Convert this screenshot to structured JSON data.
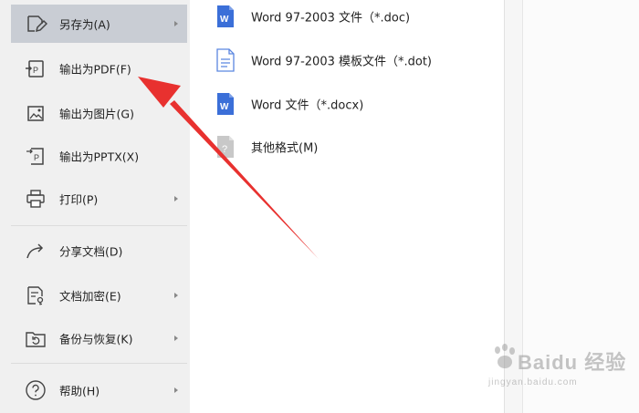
{
  "menu": {
    "items": [
      {
        "label": "另存为(A)",
        "icon": "save-as-icon",
        "has_submenu": true,
        "active": true
      },
      {
        "label": "输出为PDF(F)",
        "icon": "export-pdf-icon",
        "has_submenu": false
      },
      {
        "label": "输出为图片(G)",
        "icon": "export-image-icon",
        "has_submenu": false
      },
      {
        "label": "输出为PPTX(X)",
        "icon": "export-pptx-icon",
        "has_submenu": false
      },
      {
        "label": "打印(P)",
        "icon": "printer-icon",
        "has_submenu": true
      },
      {
        "label": "分享文档(D)",
        "icon": "share-icon",
        "has_submenu": false
      },
      {
        "label": "文档加密(E)",
        "icon": "encrypt-document-icon",
        "has_submenu": true
      },
      {
        "label": "备份与恢复(K)",
        "icon": "backup-restore-icon",
        "has_submenu": true
      },
      {
        "label": "帮助(H)",
        "icon": "help-icon",
        "has_submenu": true
      }
    ]
  },
  "submenu": {
    "items": [
      {
        "label": "Word 97-2003 文件（*.doc)",
        "icon": "word-doc-icon"
      },
      {
        "label": "Word 97-2003 模板文件（*.dot)",
        "icon": "word-template-icon"
      },
      {
        "label": "Word 文件（*.docx)",
        "icon": "word-docx-icon"
      },
      {
        "label": "其他格式(M)",
        "icon": "other-format-icon"
      }
    ]
  },
  "watermark": {
    "main": "Baidu 经验",
    "sub": "jingyan.baidu.com"
  },
  "colors": {
    "accent_blue": "#3b6fd8",
    "annotation_red": "#e8312f",
    "active_bg": "#c9cdd4"
  }
}
